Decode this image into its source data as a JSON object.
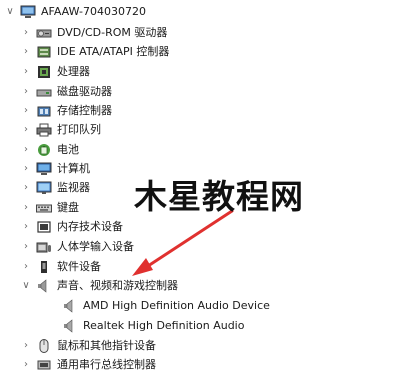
{
  "tree": {
    "root": {
      "label": "AFAAW-704030720",
      "icon": "computer-icon"
    },
    "categories": [
      {
        "label": "DVD/CD-ROM 驱动器",
        "icon": "dvd-drive-icon",
        "expanded": false
      },
      {
        "label": "IDE ATA/ATAPI 控制器",
        "icon": "ide-controller-icon",
        "expanded": false
      },
      {
        "label": "处理器",
        "icon": "processor-icon",
        "expanded": false
      },
      {
        "label": "磁盘驱动器",
        "icon": "disk-drive-icon",
        "expanded": false
      },
      {
        "label": "存储控制器",
        "icon": "storage-controller-icon",
        "expanded": false
      },
      {
        "label": "打印队列",
        "icon": "printer-icon",
        "expanded": false
      },
      {
        "label": "电池",
        "icon": "battery-icon",
        "expanded": false
      },
      {
        "label": "计算机",
        "icon": "computer-monitor-icon",
        "expanded": false
      },
      {
        "label": "监视器",
        "icon": "monitor-icon",
        "expanded": false
      },
      {
        "label": "键盘",
        "icon": "keyboard-icon",
        "expanded": false
      },
      {
        "label": "内存技术设备",
        "icon": "memory-device-icon",
        "expanded": false
      },
      {
        "label": "人体学输入设备",
        "icon": "hid-icon",
        "expanded": false
      },
      {
        "label": "软件设备",
        "icon": "software-device-icon",
        "expanded": false
      },
      {
        "label": "声音、视频和游戏控制器",
        "icon": "speaker-icon",
        "expanded": true
      },
      {
        "label": "鼠标和其他指针设备",
        "icon": "mouse-icon",
        "expanded": false
      },
      {
        "label": "通用串行总线控制器",
        "icon": "usb-icon",
        "expanded": false
      }
    ],
    "audio_children": [
      {
        "label": "AMD High Definition Audio Device",
        "icon": "speaker-icon"
      },
      {
        "label": "Realtek High Definition Audio",
        "icon": "speaker-icon"
      }
    ]
  },
  "watermark": {
    "text": "木星教程网"
  },
  "colors": {
    "arrow": "#e0312f",
    "chevron": "#6b6b6b",
    "text": "#1a1a1a",
    "background": "#ffffff"
  }
}
